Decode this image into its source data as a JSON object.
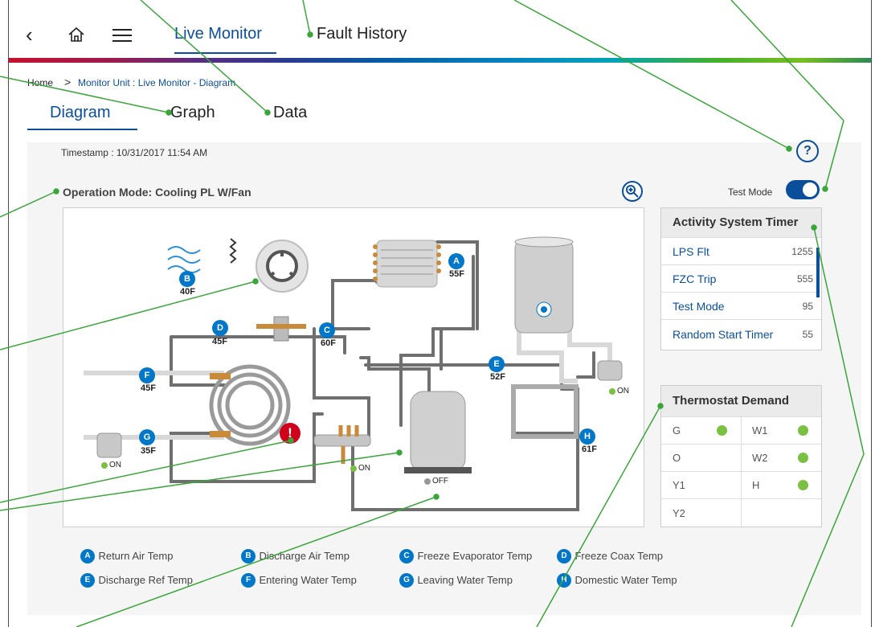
{
  "nav": {
    "live_monitor": "Live Monitor",
    "fault_history": "Fault History"
  },
  "breadcrumb": {
    "home": "Home",
    "separator": ">",
    "path": "Monitor Unit : Live Monitor - Diagram"
  },
  "subtabs": {
    "diagram": "Diagram",
    "graph": "Graph",
    "data": "Data"
  },
  "timestamp": "Timestamp : 10/31/2017   11:54 AM",
  "operation_mode": "Operation Mode: Cooling PL W/Fan",
  "help_label": "?",
  "test_mode_label": "Test Mode",
  "test_mode_on": true,
  "activity_timer": {
    "title": "Activity System Timer",
    "rows": [
      {
        "label": "LPS Flt",
        "value": "1255"
      },
      {
        "label": "FZC Trip",
        "value": "555"
      },
      {
        "label": "Test Mode",
        "value": "95"
      },
      {
        "label": "Random Start Timer",
        "value": "55"
      }
    ]
  },
  "thermostat": {
    "title": "Thermostat Demand",
    "rows": [
      [
        "G",
        "W1"
      ],
      [
        "O",
        "W2"
      ],
      [
        "Y1",
        "H"
      ],
      [
        "Y2",
        ""
      ]
    ]
  },
  "sensors": {
    "A": {
      "letter": "A",
      "value": "55F"
    },
    "B": {
      "letter": "B",
      "value": "40F"
    },
    "C": {
      "letter": "C",
      "value": "60F"
    },
    "D": {
      "letter": "D",
      "value": "45F"
    },
    "E": {
      "letter": "E",
      "value": "52F"
    },
    "F": {
      "letter": "F",
      "value": "45F"
    },
    "G": {
      "letter": "G",
      "value": "35F"
    },
    "H": {
      "letter": "H",
      "value": "61F"
    }
  },
  "status": {
    "on": "ON",
    "off": "OFF"
  },
  "fault_icon": "!",
  "legend": [
    {
      "letter": "A",
      "label": "Return Air Temp"
    },
    {
      "letter": "B",
      "label": "Discharge Air Temp"
    },
    {
      "letter": "C",
      "label": "Freeze Evaporator Temp"
    },
    {
      "letter": "D",
      "label": "Freeze Coax Temp"
    },
    {
      "letter": "E",
      "label": "Discharge Ref Temp"
    },
    {
      "letter": "F",
      "label": "Entering Water Temp"
    },
    {
      "letter": "G",
      "label": "Leaving Water Temp"
    },
    {
      "letter": "H",
      "label": "Domestic Water Temp"
    }
  ],
  "colors": {
    "accent": "#0b4f9c",
    "badge": "#0077c8",
    "indicator": "#7ac143",
    "fault": "#d0021b",
    "callout": "#3aa63a"
  }
}
